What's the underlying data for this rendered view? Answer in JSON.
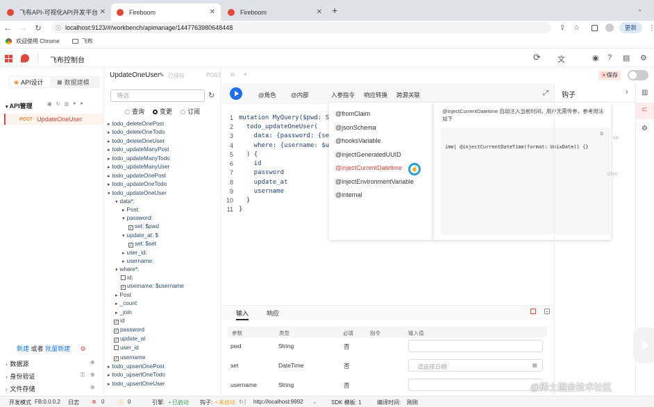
{
  "browser": {
    "tabs": [
      {
        "label": "飞布API-可视化API开发平台"
      },
      {
        "label": "Fireboom"
      },
      {
        "label": "Fireboom"
      }
    ],
    "url": "localhost:9123/#/workbench/apimanage/1447763980648448",
    "update_label": "更新",
    "bookmarks": [
      {
        "label": "欢迎使用 Chrome"
      },
      {
        "label": "飞布"
      }
    ]
  },
  "app": {
    "title": "飞布控制台",
    "top_tabs": [
      {
        "label": "API设计"
      },
      {
        "label": "数据建模"
      }
    ],
    "api_manage_label": "API管理",
    "api_item": {
      "method": "POST",
      "name": "UpdateOneUser"
    },
    "new_text": "新建",
    "or_text": "或者",
    "batch_new_text": "批量新建",
    "bottom_sections": [
      {
        "label": "数据源"
      },
      {
        "label": "身份验证"
      },
      {
        "label": "文件存储"
      }
    ]
  },
  "header": {
    "op_name": "UpdateOneUser",
    "saved_label": "已保存",
    "method": "POST",
    "save_label": "保存"
  },
  "tree": {
    "search_placeholder": "筛选",
    "radios": [
      {
        "label": "查询"
      },
      {
        "label": "变更"
      },
      {
        "label": "订阅"
      }
    ],
    "items": [
      {
        "text": "todo_deleteOnePost"
      },
      {
        "text": "todo_deleteOneTodo"
      },
      {
        "text": "todo_deleteOneUser"
      },
      {
        "text": "todo_updateManyPost"
      },
      {
        "text": "todo_updateManyTodo"
      },
      {
        "text": "todo_updateManyUser"
      },
      {
        "text": "todo_updateOnePost"
      },
      {
        "text": "todo_updateOneTodo"
      },
      {
        "text": "todo_updateOneUser"
      },
      {
        "text": "data*:"
      },
      {
        "text": "Post:"
      },
      {
        "text": "password:"
      },
      {
        "text": "set: $pwd"
      },
      {
        "text": "update_at: $"
      },
      {
        "text": "set: $set"
      },
      {
        "text": "user_id:"
      },
      {
        "text": "username:"
      },
      {
        "text": "where*:"
      },
      {
        "text": "id:"
      },
      {
        "text": "username: $username"
      },
      {
        "text": "Post"
      },
      {
        "text": "_count"
      },
      {
        "text": "_join"
      },
      {
        "text": "id"
      },
      {
        "text": "password"
      },
      {
        "text": "update_at"
      },
      {
        "text": "user_id"
      },
      {
        "text": "username"
      },
      {
        "text": "todo_upsertOnePost"
      },
      {
        "text": "todo_upsertOneTodo"
      },
      {
        "text": "todo_upsertOneUser"
      }
    ]
  },
  "toolbar": {
    "role_label": "@角色",
    "internal_label": "@内部",
    "input_directive": "入参指令",
    "response_transform": "响应转换",
    "cross_source": "跨源关联"
  },
  "editor": {
    "line_numbers": [
      "1",
      "2",
      "3",
      "4",
      "5",
      "6",
      "7",
      "8",
      "9",
      "10",
      "11"
    ],
    "lines": [
      "mutation MyQuery($pwd: St",
      "  todo_updateOneUser(",
      "    data: {password: {set",
      "    where: {username: $us",
      "  ) {",
      "    id",
      "    password",
      "    update_at",
      "    username",
      "  }",
      "}"
    ]
  },
  "suggestions": [
    {
      "text": "@fromClaim"
    },
    {
      "text": "@jsonSchema"
    },
    {
      "text": "@hooksVariable"
    },
    {
      "text": "@injectGeneratedUUID"
    },
    {
      "text": "@injectCurrentDatetime"
    },
    {
      "text": "@injectEnvironmentVariable"
    },
    {
      "text": "@internal"
    }
  ],
  "doc": {
    "description": "@injectCurrentDatetime 自动注入当前时间，用户无需传参，参考用法如下",
    "code": "ime| @injectCurrentDateTime(format: UnixDate)) {}"
  },
  "right_panel": {
    "title": "钩子",
    "peek1": "ve",
    "peek2": "olve"
  },
  "params": {
    "tabs": [
      {
        "label": "输入"
      },
      {
        "label": "响应"
      }
    ],
    "headers": [
      "参数",
      "类型",
      "必填",
      "指令",
      "输入值"
    ],
    "rows": [
      {
        "name": "pwd",
        "type": "String",
        "required": "否"
      },
      {
        "name": "set",
        "type": "DateTime",
        "required": "否",
        "placeholder": "请选择日期"
      },
      {
        "name": "username",
        "type": "String",
        "required": "否"
      }
    ]
  },
  "statusbar": {
    "mode": "开发模式",
    "version": "FB:0.0.0.2",
    "log": "日志",
    "errors": "0",
    "warnings": "0",
    "engine_label": "引擎:",
    "engine_status": "• 已启动",
    "hook_label": "钩子:",
    "hook_status": "• 未启动",
    "host": "http://localhost:9992",
    "sdk": "SDK 模板: 1",
    "compile_label": "编译时间:",
    "compile_time": "刚刚"
  },
  "watermark": "@稀土掘金技术社区",
  "colors": {
    "accent": "#1e6ff1",
    "brand_red": "#e0463a",
    "post": "#f08a35",
    "green": "#3ba55c",
    "orange": "#f0a020",
    "link": "#1677ff",
    "highlight": "#d4463a"
  }
}
